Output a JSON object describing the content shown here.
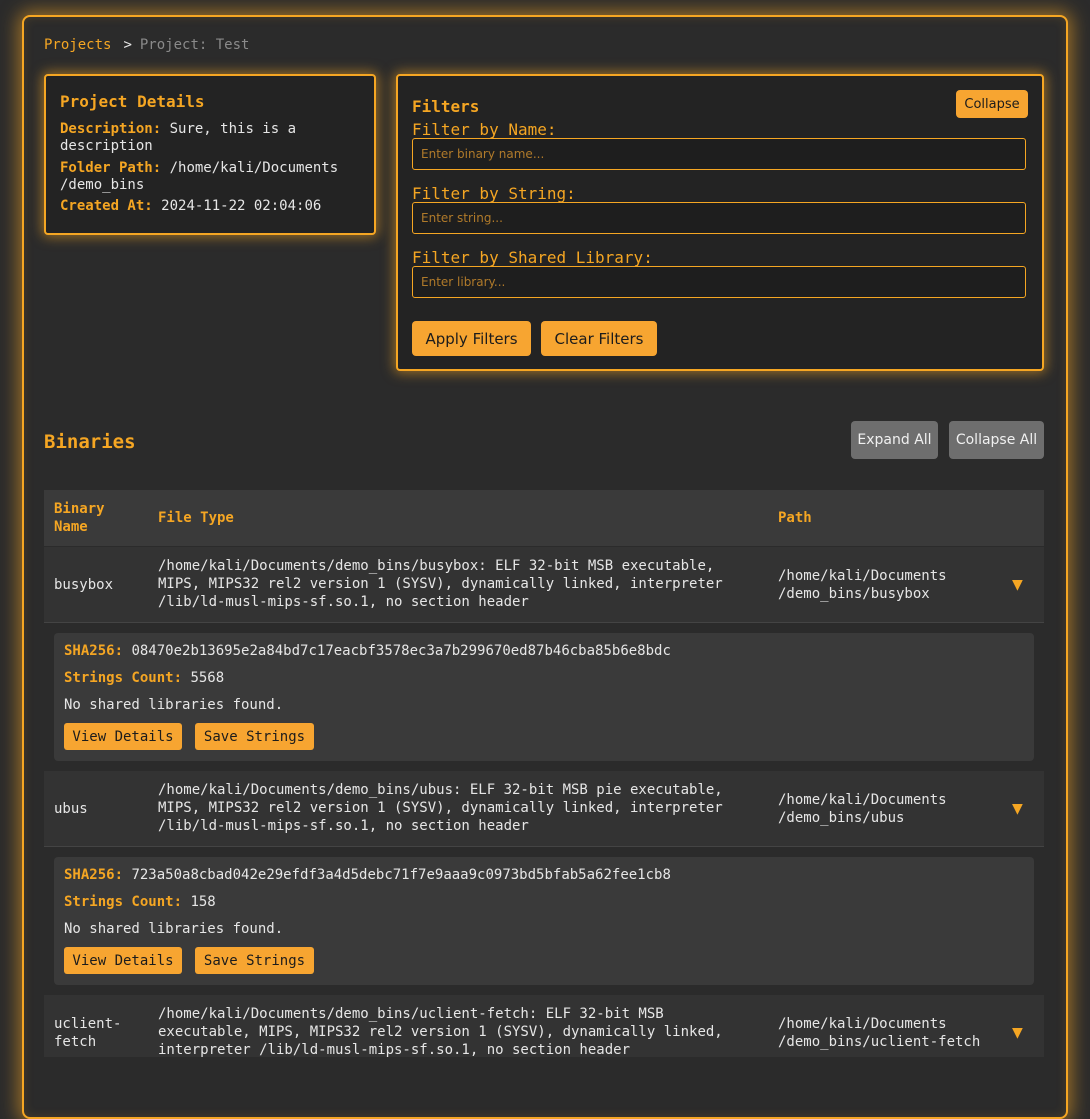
{
  "breadcrumb": {
    "projects": "Projects",
    "separator": ">",
    "current": "Project: Test"
  },
  "details": {
    "title": "Project Details",
    "description_label": "Description:",
    "description": "Sure, this is a description",
    "folder_label": "Folder Path:",
    "folder": "/home/kali/Documents /demo_bins",
    "created_label": "Created At:",
    "created": "2024-11-22 02:04:06"
  },
  "filters": {
    "title": "Filters",
    "collapse": "Collapse",
    "name_label": "Filter by Name:",
    "name_placeholder": "Enter binary name...",
    "string_label": "Filter by String:",
    "string_placeholder": "Enter string...",
    "library_label": "Filter by Shared Library:",
    "library_placeholder": "Enter library...",
    "apply": "Apply Filters",
    "clear": "Clear Filters"
  },
  "binaries": {
    "title": "Binaries",
    "expand_all": "Expand All",
    "collapse_all": "Collapse All",
    "columns": {
      "name": "Binary Name",
      "file_type": "File Type",
      "path": "Path"
    },
    "rows": [
      {
        "name": "busybox",
        "file_type": "/home/kali/Documents/demo_bins/busybox: ELF 32-bit MSB executable, MIPS, MIPS32 rel2 version 1 (SYSV), dynamically linked, interpreter /lib/ld-musl-mips-sf.so.1, no section header",
        "path": "/home/kali/Documents /demo_bins/busybox",
        "toggle": "▼",
        "sha_label": "SHA256:",
        "sha": "08470e2b13695e2a84bd7c17eacbf3578ec3a7b299670ed87b46cba85b6e8bdc",
        "strings_label": "Strings Count:",
        "strings": "5568",
        "libs": "No shared libraries found.",
        "view": "View Details",
        "save": "Save Strings"
      },
      {
        "name": "ubus",
        "file_type": "/home/kali/Documents/demo_bins/ubus: ELF 32-bit MSB pie executable, MIPS, MIPS32 rel2 version 1 (SYSV), dynamically linked, interpreter /lib/ld-musl-mips-sf.so.1, no section header",
        "path": "/home/kali/Documents /demo_bins/ubus",
        "toggle": "▼",
        "sha_label": "SHA256:",
        "sha": "723a50a8cbad042e29efdf3a4d5debc71f7e9aaa9c0973bd5bfab5a62fee1cb8",
        "strings_label": "Strings Count:",
        "strings": "158",
        "libs": "No shared libraries found.",
        "view": "View Details",
        "save": "Save Strings"
      },
      {
        "name": "uclient-fetch",
        "file_type": "/home/kali/Documents/demo_bins/uclient-fetch: ELF 32-bit MSB executable, MIPS, MIPS32 rel2 version 1 (SYSV), dynamically linked, interpreter /lib/ld-musl-mips-sf.so.1, no section header",
        "path": "/home/kali/Documents /demo_bins/uclient-fetch",
        "toggle": "▼"
      }
    ]
  }
}
